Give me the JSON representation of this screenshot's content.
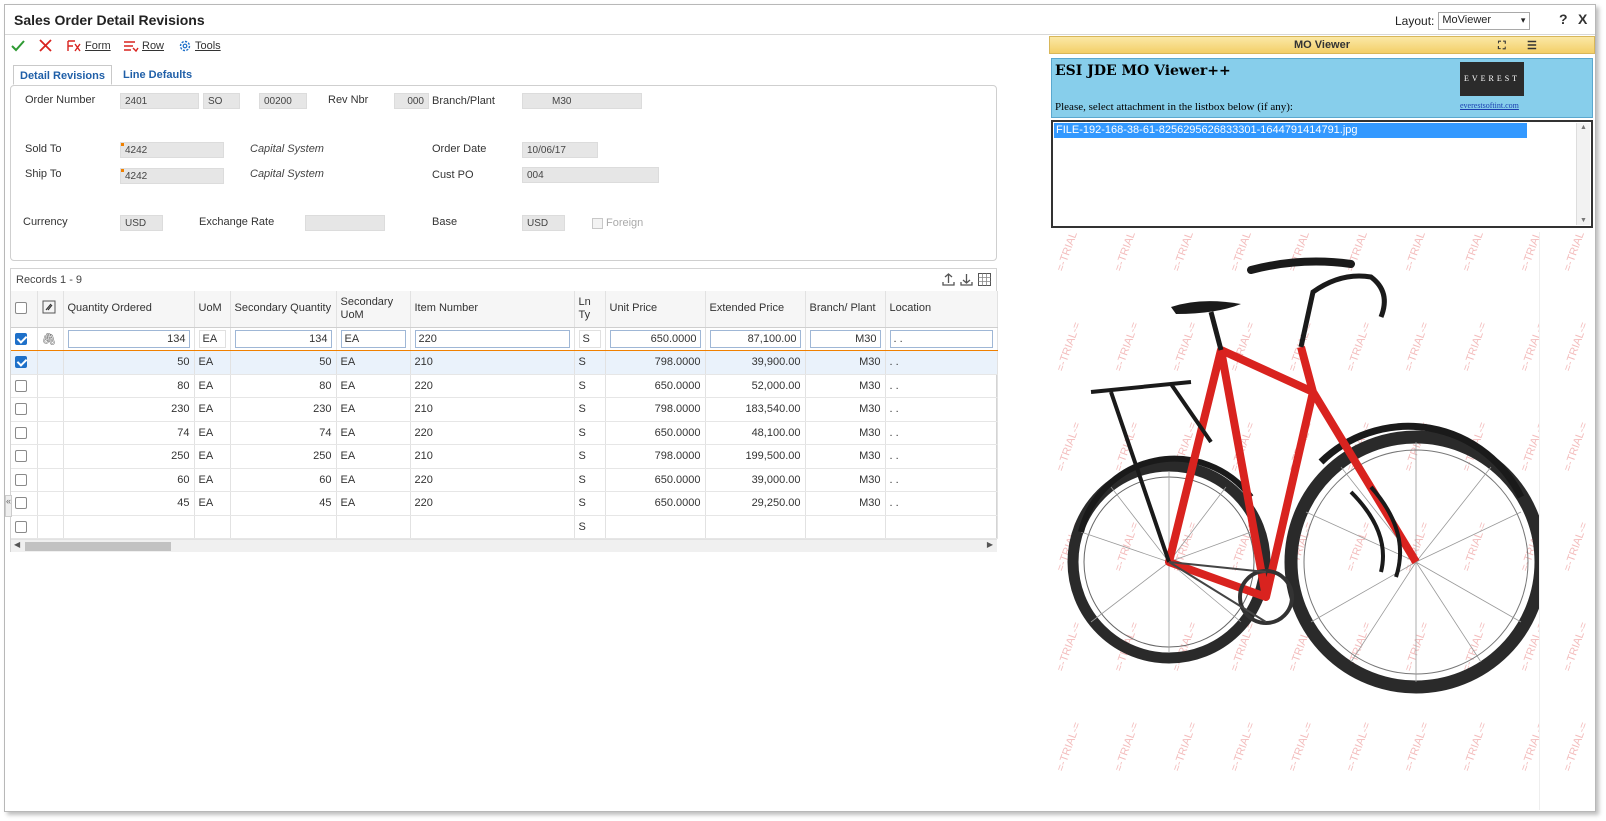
{
  "window": {
    "title": "Sales Order Detail Revisions",
    "layout_label": "Layout:",
    "layout_value": "MoViewer",
    "help": "?",
    "close": "X"
  },
  "toolbar": {
    "form_label": "Form",
    "row_label": "Row",
    "tools_label": "Tools"
  },
  "tabs": [
    "Detail Revisions",
    "Line Defaults"
  ],
  "form": {
    "order_number_label": "Order Number",
    "order_number": "2401",
    "order_type": "SO",
    "order_company": "00200",
    "rev_nbr_label": "Rev Nbr",
    "rev_nbr": "000",
    "branch_plant_label": "Branch/Plant",
    "branch_plant": "M30",
    "sold_to_label": "Sold To",
    "sold_to": "4242",
    "sold_to_name": "Capital System",
    "order_date_label": "Order Date",
    "order_date": "10/06/17",
    "ship_to_label": "Ship To",
    "ship_to": "4242",
    "ship_to_name": "Capital System",
    "cust_po_label": "Cust PO",
    "cust_po": "004",
    "currency_label": "Currency",
    "currency": "USD",
    "exchange_rate_label": "Exchange Rate",
    "exchange_rate": "",
    "base_label": "Base",
    "base": "USD",
    "foreign_label": "Foreign"
  },
  "grid": {
    "records": "Records 1 - 9",
    "headers": {
      "qty": "Quantity Ordered",
      "uom": "UoM",
      "sec_qty": "Secondary Quantity",
      "sec_uom": "Secondary UoM",
      "item": "Item Number",
      "ln_ty": "Ln Ty",
      "unit_price": "Unit Price",
      "ext_price": "Extended Price",
      "branch": "Branch/ Plant",
      "location": "Location"
    },
    "rows": [
      {
        "qty": "134",
        "uom": "EA",
        "sec_qty": "134",
        "sec_uom": "EA",
        "item": "220",
        "ln_ty": "S",
        "unit_price": "650.0000",
        "ext_price": "87,100.00",
        "branch": "M30",
        "location": ". ."
      },
      {
        "qty": "50",
        "uom": "EA",
        "sec_qty": "50",
        "sec_uom": "EA",
        "item": "210",
        "ln_ty": "S",
        "unit_price": "798.0000",
        "ext_price": "39,900.00",
        "branch": "M30",
        "location": ". ."
      },
      {
        "qty": "80",
        "uom": "EA",
        "sec_qty": "80",
        "sec_uom": "EA",
        "item": "220",
        "ln_ty": "S",
        "unit_price": "650.0000",
        "ext_price": "52,000.00",
        "branch": "M30",
        "location": ". ."
      },
      {
        "qty": "230",
        "uom": "EA",
        "sec_qty": "230",
        "sec_uom": "EA",
        "item": "210",
        "ln_ty": "S",
        "unit_price": "798.0000",
        "ext_price": "183,540.00",
        "branch": "M30",
        "location": ". ."
      },
      {
        "qty": "74",
        "uom": "EA",
        "sec_qty": "74",
        "sec_uom": "EA",
        "item": "220",
        "ln_ty": "S",
        "unit_price": "650.0000",
        "ext_price": "48,100.00",
        "branch": "M30",
        "location": ". ."
      },
      {
        "qty": "250",
        "uom": "EA",
        "sec_qty": "250",
        "sec_uom": "EA",
        "item": "210",
        "ln_ty": "S",
        "unit_price": "798.0000",
        "ext_price": "199,500.00",
        "branch": "M30",
        "location": ". ."
      },
      {
        "qty": "60",
        "uom": "EA",
        "sec_qty": "60",
        "sec_uom": "EA",
        "item": "220",
        "ln_ty": "S",
        "unit_price": "650.0000",
        "ext_price": "39,000.00",
        "branch": "M30",
        "location": ". ."
      },
      {
        "qty": "45",
        "uom": "EA",
        "sec_qty": "45",
        "sec_uom": "EA",
        "item": "220",
        "ln_ty": "S",
        "unit_price": "650.0000",
        "ext_price": "29,250.00",
        "branch": "M30",
        "location": ". ."
      },
      {
        "qty": "",
        "uom": "",
        "sec_qty": "",
        "sec_uom": "",
        "item": "",
        "ln_ty": "S",
        "unit_price": "",
        "ext_price": "",
        "branch": "",
        "location": ""
      }
    ]
  },
  "viewer": {
    "panel_title": "MO Viewer",
    "heading": "ESI JDE MO Viewer++",
    "instruction": "Please, select attachment in the listbox below (if any):",
    "logo_text": "EVEREST",
    "link_text": "everestsoftint.com",
    "attachment": "FILE-192-168-38-61-8256295626833301-1644791414791.jpg",
    "watermark": "=-TRIAL-="
  },
  "colors": {
    "accent_blue": "#1e70c9",
    "tab_blue": "#1f5fa8",
    "required_orange": "#f08000",
    "viewer_header": "#87ceeb",
    "bike_red": "#d9231f"
  }
}
